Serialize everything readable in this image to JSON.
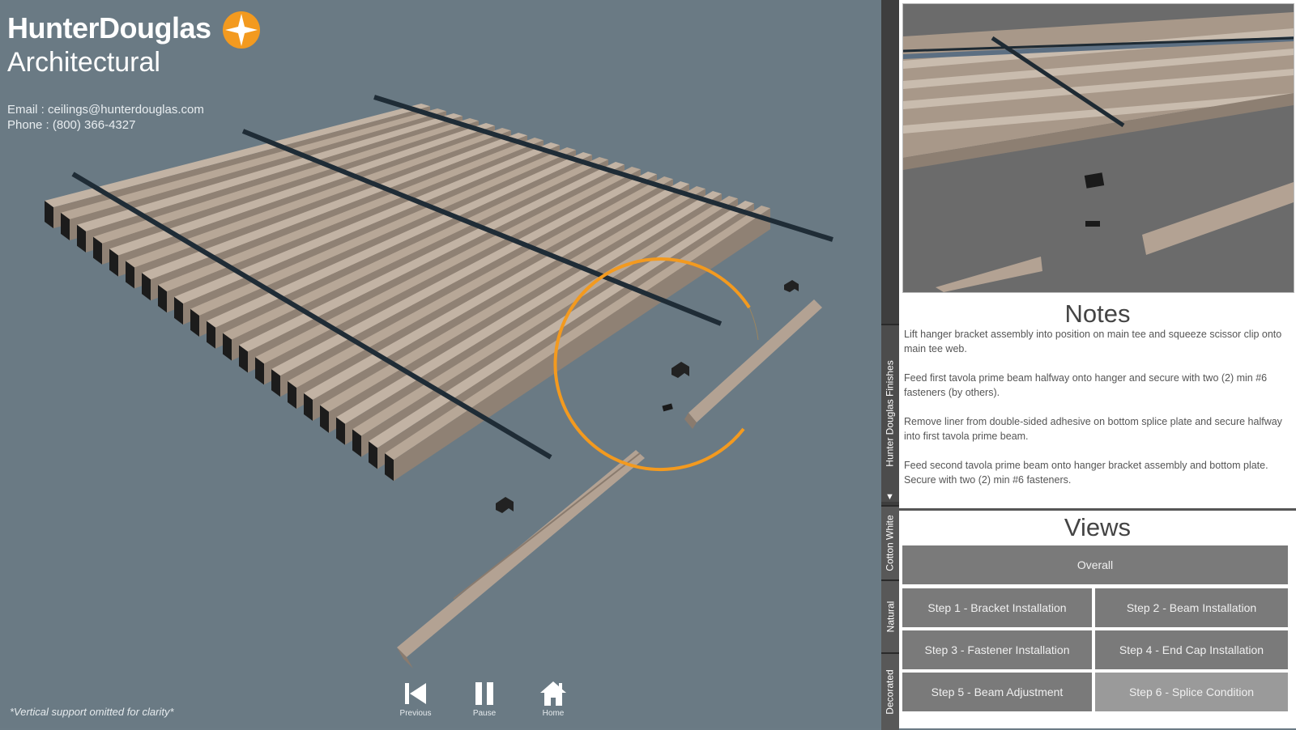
{
  "brand": {
    "name": "HunterDouglas",
    "sub": "Architectural",
    "accent": "#f39a1f"
  },
  "contact": {
    "email": "Email : ceilings@hunterdouglas.com",
    "phone": "Phone : (800) 366-4327"
  },
  "footnote": "*Vertical support omitted for clarity*",
  "controls": [
    {
      "label": "Previous",
      "icon": "skip-back-icon"
    },
    {
      "label": "Pause",
      "icon": "pause-icon"
    },
    {
      "label": "Home",
      "icon": "home-icon"
    }
  ],
  "side_tabs": [
    "Hunter Douglas Finishes",
    "Cotton White",
    "Natural",
    "Decorated"
  ],
  "notes": {
    "title": "Notes",
    "paragraphs": [
      "Lift hanger bracket assembly into position on main tee and squeeze scissor clip onto main tee web.",
      "Feed first tavola prime beam halfway onto hanger and secure with two (2) min #6 fasteners (by others).",
      "Remove liner from double-sided adhesive on bottom splice plate and secure halfway into first tavola prime beam.",
      "Feed second tavola prime beam onto hanger bracket assembly and bottom plate. Secure with two (2) min #6 fasteners."
    ]
  },
  "views": {
    "title": "Views",
    "overall": "Overall",
    "steps": [
      "Step 1 - Bracket Installation",
      "Step 2 - Beam Installation",
      "Step 3 - Fastener Installation",
      "Step 4 - End Cap Installation",
      "Step 5 - Beam Adjustment",
      "Step 6 - Splice Condition"
    ],
    "selected": "Step 6 - Splice Condition"
  }
}
